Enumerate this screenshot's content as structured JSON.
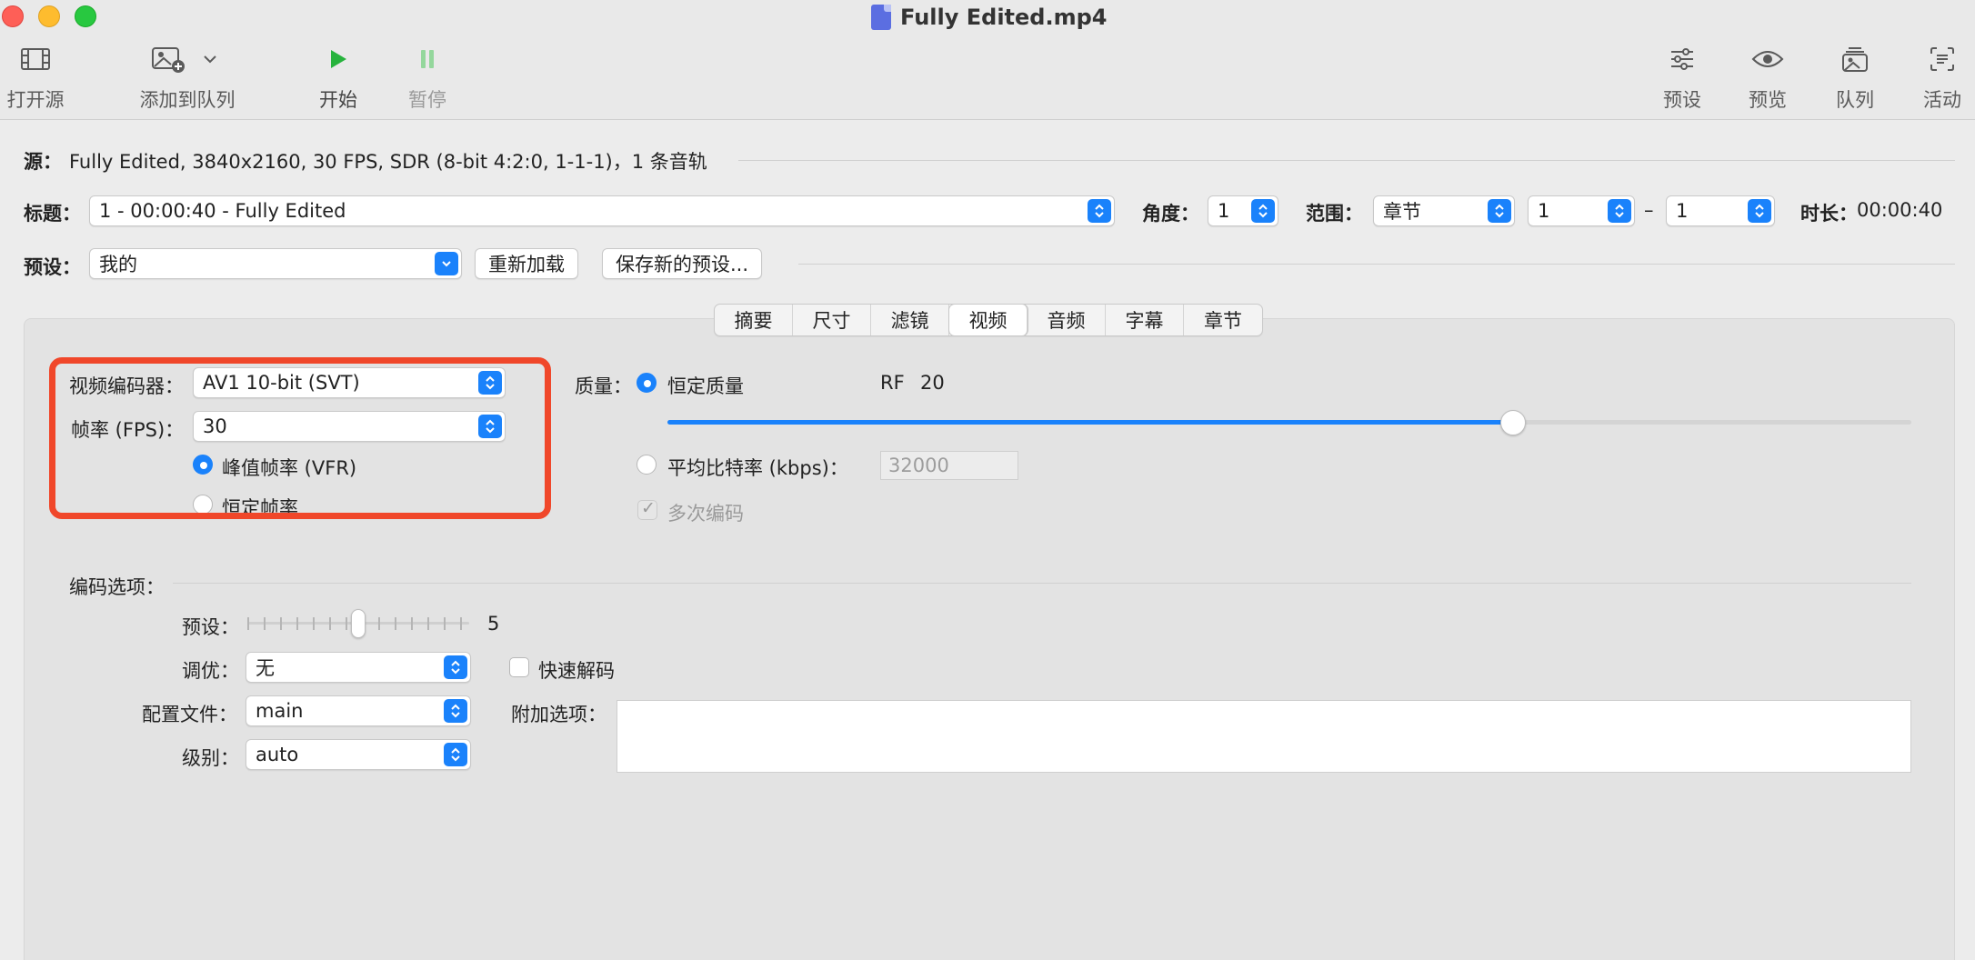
{
  "window": {
    "title": "Fully Edited.mp4"
  },
  "toolbar": {
    "open_source": "打开源",
    "add_to_queue": "添加到队列",
    "start": "开始",
    "pause": "暂停",
    "presets": "预设",
    "preview": "预览",
    "queue": "队列",
    "activity": "活动"
  },
  "source": {
    "label": "源：",
    "value": "Fully Edited, 3840x2160, 30 FPS, SDR (8-bit 4:2:0, 1-1-1)，1 条音轨"
  },
  "title_row": {
    "label": "标题：",
    "title_value": "1 - 00:00:40 - Fully Edited",
    "angle_label": "角度：",
    "angle_value": "1",
    "range_label": "范围：",
    "range_type": "章节",
    "range_start": "1",
    "range_dash": "–",
    "range_end": "1",
    "duration_label": "时长：",
    "duration_value": "00:00:40"
  },
  "preset_row": {
    "label": "预设：",
    "value": "我的",
    "reload_button": "重新加载",
    "save_new_button": "保存新的预设..."
  },
  "tabs": [
    "摘要",
    "尺寸",
    "滤镜",
    "视频",
    "音频",
    "字幕",
    "章节"
  ],
  "active_tab": "视频",
  "video": {
    "encoder_label": "视频编码器：",
    "encoder_value": "AV1 10-bit (SVT)",
    "fps_label": "帧率 (FPS)：",
    "fps_value": "30",
    "peak_fps": "峰值帧率 (VFR)",
    "constant_fps": "恒定帧率"
  },
  "quality": {
    "label": "质量：",
    "constant_quality": "恒定质量",
    "rf_label": "RF",
    "rf_value": "20",
    "slider_fraction": 0.68,
    "avg_bitrate": "平均比特率 (kbps)：",
    "bitrate_value": "32000",
    "multipass": "多次编码"
  },
  "encoder_options": {
    "header": "编码选项：",
    "preset_label": "预设：",
    "preset_value": "5",
    "tune_label": "调优：",
    "tune_value": "无",
    "fast_decode": "快速解码",
    "profile_label": "配置文件：",
    "profile_value": "main",
    "extra_label": "附加选项：",
    "level_label": "级别：",
    "level_value": "auto"
  },
  "colors": {
    "accent": "#1a82fb",
    "highlight": "#f0472a"
  }
}
